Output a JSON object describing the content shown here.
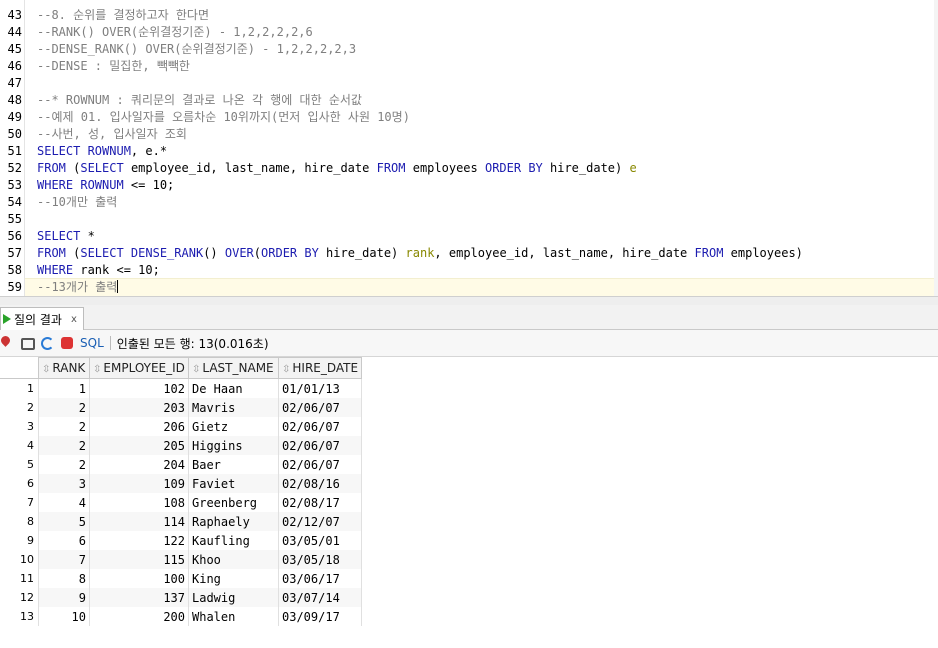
{
  "editor": {
    "lines": [
      {
        "no": "43",
        "segments": [
          {
            "t": "--8. 순위를 결정하고자 한다면",
            "c": "cm"
          }
        ]
      },
      {
        "no": "44",
        "segments": [
          {
            "t": "--RANK() OVER(순위결정기준) - 1,2,2,2,2,6",
            "c": "cm"
          }
        ]
      },
      {
        "no": "45",
        "segments": [
          {
            "t": "--DENSE_RANK() OVER(순위결정기준) - 1,2,2,2,2,3",
            "c": "cm"
          }
        ]
      },
      {
        "no": "46",
        "segments": [
          {
            "t": "--DENSE : 밀집한, 빽빽한",
            "c": "cm"
          }
        ]
      },
      {
        "no": "47",
        "segments": []
      },
      {
        "no": "48",
        "segments": [
          {
            "t": "--* ROWNUM : 쿼리문의 결과로 나온 각 행에 대한 순서값",
            "c": "cm"
          }
        ]
      },
      {
        "no": "49",
        "segments": [
          {
            "t": "--예제 01. 입사일자를 오름차순 10위까지(먼저 입사한 사원 10명)",
            "c": "cm"
          }
        ]
      },
      {
        "no": "50",
        "segments": [
          {
            "t": "--사번, 성, 입사일자 조회",
            "c": "cm"
          }
        ]
      },
      {
        "no": "51",
        "segments": [
          {
            "t": "SELECT ROWNUM",
            "c": "kw"
          },
          {
            "t": ", e.*",
            "c": ""
          }
        ]
      },
      {
        "no": "52",
        "segments": [
          {
            "t": "FROM",
            "c": "kw"
          },
          {
            "t": " (",
            "c": ""
          },
          {
            "t": "SELECT",
            "c": "kw"
          },
          {
            "t": " employee_id, last_name, hire_date ",
            "c": ""
          },
          {
            "t": "FROM",
            "c": "kw"
          },
          {
            "t": " employees ",
            "c": ""
          },
          {
            "t": "ORDER BY",
            "c": "kw"
          },
          {
            "t": " hire_date) ",
            "c": ""
          },
          {
            "t": "e",
            "c": "al"
          }
        ]
      },
      {
        "no": "53",
        "segments": [
          {
            "t": "WHERE ROWNUM",
            "c": "kw"
          },
          {
            "t": " <= 10;",
            "c": ""
          }
        ]
      },
      {
        "no": "54",
        "segments": [
          {
            "t": "--10개만 출력",
            "c": "cm"
          }
        ]
      },
      {
        "no": "55",
        "segments": []
      },
      {
        "no": "56",
        "segments": [
          {
            "t": "SELECT",
            "c": "kw"
          },
          {
            "t": " *",
            "c": ""
          }
        ]
      },
      {
        "no": "57",
        "segments": [
          {
            "t": "FROM",
            "c": "kw"
          },
          {
            "t": " (",
            "c": ""
          },
          {
            "t": "SELECT DENSE_RANK",
            "c": "kw"
          },
          {
            "t": "() ",
            "c": ""
          },
          {
            "t": "OVER",
            "c": "kw"
          },
          {
            "t": "(",
            "c": ""
          },
          {
            "t": "ORDER BY",
            "c": "kw"
          },
          {
            "t": " hire_date) ",
            "c": ""
          },
          {
            "t": "rank",
            "c": "al"
          },
          {
            "t": ", employee_id, last_name, hire_date ",
            "c": ""
          },
          {
            "t": "FROM",
            "c": "kw"
          },
          {
            "t": " employees)",
            "c": ""
          }
        ]
      },
      {
        "no": "58",
        "segments": [
          {
            "t": "WHERE",
            "c": "kw"
          },
          {
            "t": " rank <= 10;",
            "c": ""
          }
        ]
      },
      {
        "no": "59",
        "segments": [
          {
            "t": "--13개가 출력",
            "c": "cm"
          }
        ]
      }
    ]
  },
  "results": {
    "tab_label": "질의 결과",
    "tab_close": "x",
    "toolbar": {
      "sql_label": "SQL",
      "status": "인출된 모든 행: 13(0.016초)"
    },
    "columns": [
      "RANK",
      "EMPLOYEE_ID",
      "LAST_NAME",
      "HIRE_DATE"
    ],
    "rows": [
      [
        "1",
        "1",
        "102",
        "De Haan",
        "01/01/13"
      ],
      [
        "2",
        "2",
        "203",
        "Mavris",
        "02/06/07"
      ],
      [
        "3",
        "2",
        "206",
        "Gietz",
        "02/06/07"
      ],
      [
        "4",
        "2",
        "205",
        "Higgins",
        "02/06/07"
      ],
      [
        "5",
        "2",
        "204",
        "Baer",
        "02/06/07"
      ],
      [
        "6",
        "3",
        "109",
        "Faviet",
        "02/08/16"
      ],
      [
        "7",
        "4",
        "108",
        "Greenberg",
        "02/08/17"
      ],
      [
        "8",
        "5",
        "114",
        "Raphaely",
        "02/12/07"
      ],
      [
        "9",
        "6",
        "122",
        "Kaufling",
        "03/05/01"
      ],
      [
        "10",
        "7",
        "115",
        "Khoo",
        "03/05/18"
      ],
      [
        "11",
        "8",
        "100",
        "King",
        "03/06/17"
      ],
      [
        "12",
        "9",
        "137",
        "Ladwig",
        "03/07/14"
      ],
      [
        "13",
        "10",
        "200",
        "Whalen",
        "03/09/17"
      ]
    ]
  },
  "colors": {
    "keyword": "#1c1cb0",
    "comment": "#7f7f7f",
    "alias": "#888800",
    "run_icon": "#2aa32a"
  }
}
